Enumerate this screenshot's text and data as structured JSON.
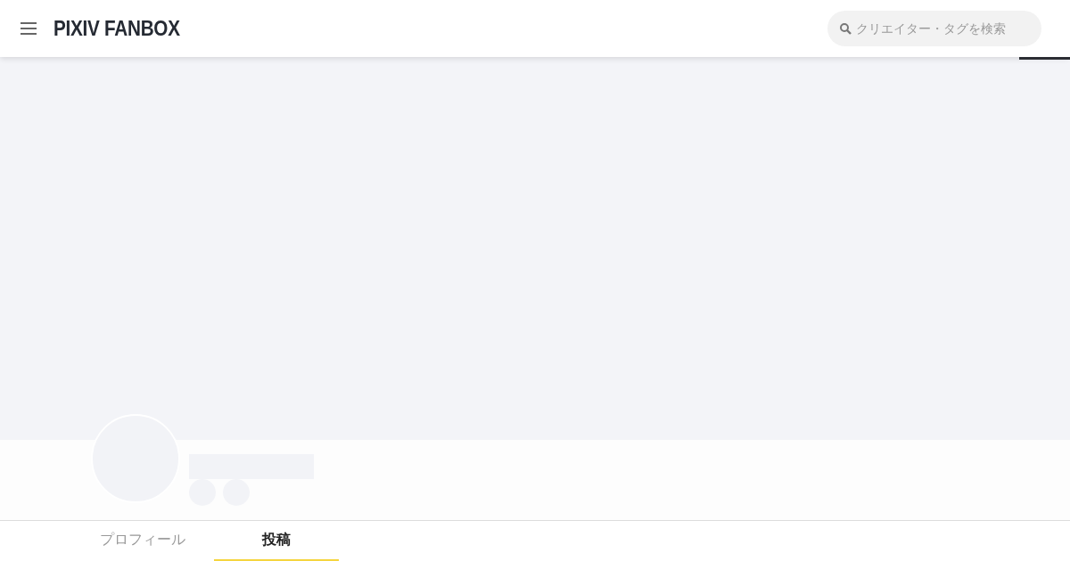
{
  "header": {
    "logo": "PIXIV FANBOX",
    "search": {
      "placeholder": "クリエイター・タグを検索"
    }
  },
  "tabs": [
    {
      "label": "プロフィール",
      "selected": false
    },
    {
      "label": "投稿",
      "selected": true
    }
  ]
}
